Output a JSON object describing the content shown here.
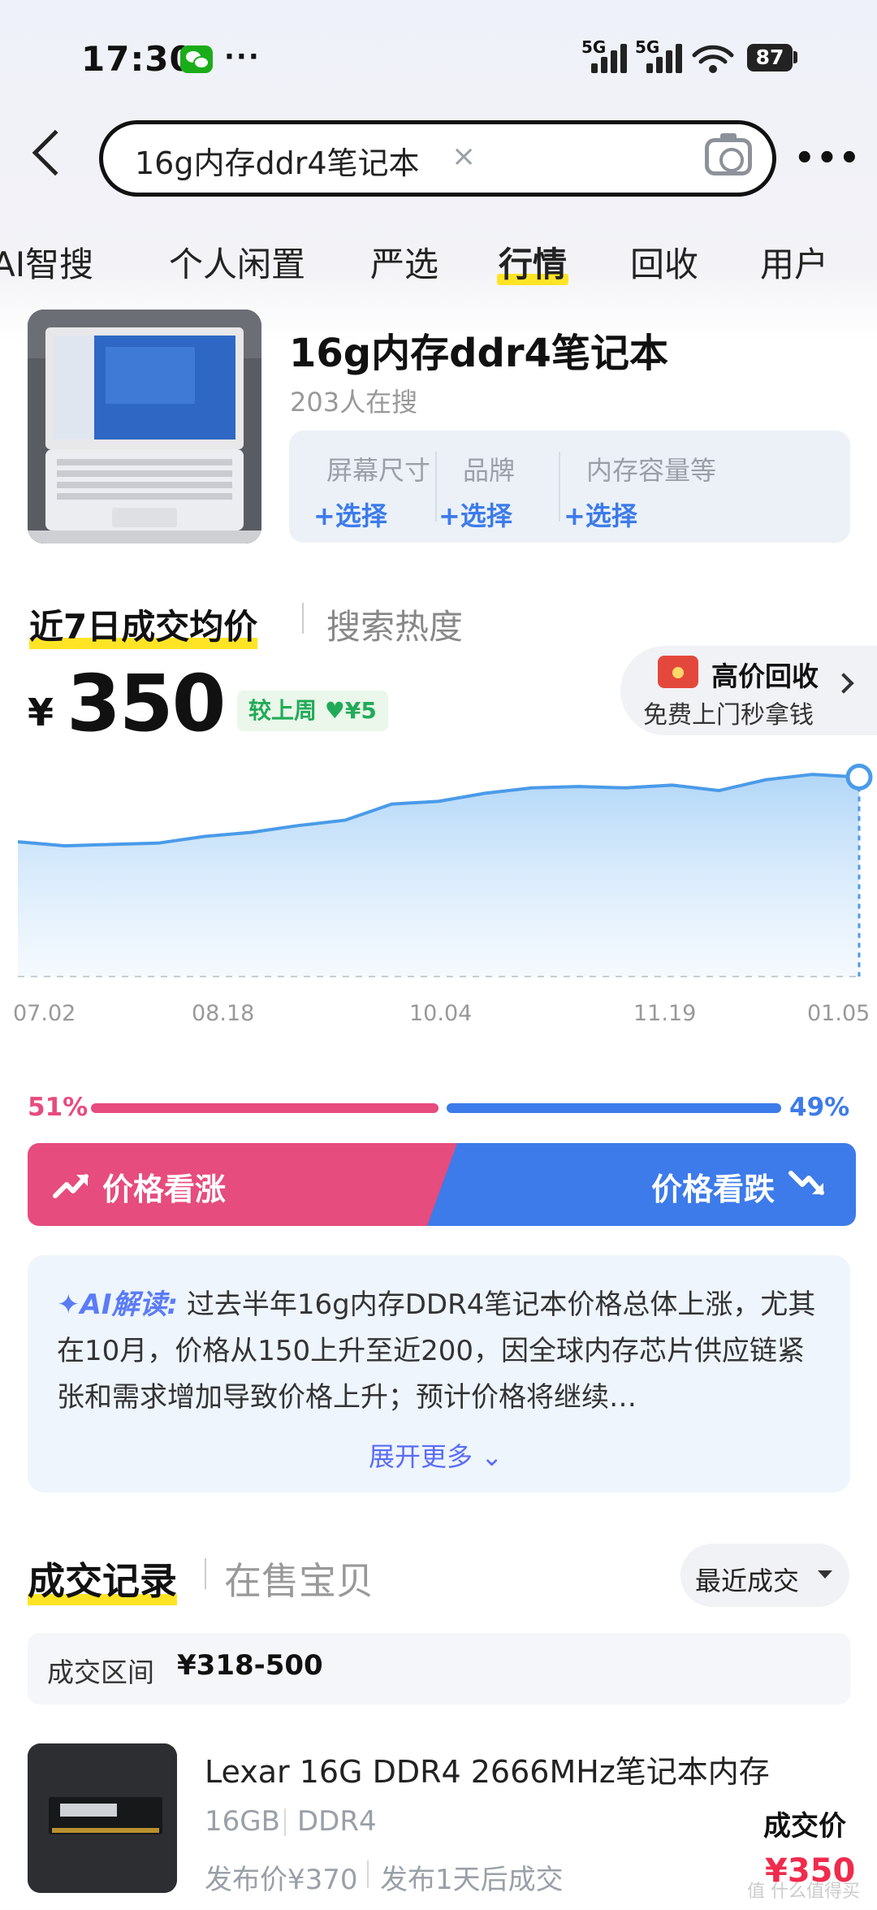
{
  "status_bar": {
    "time": "17:30",
    "battery": "87",
    "network": "5G"
  },
  "search": {
    "query": "16g内存ddr4笔记本",
    "clear": "×"
  },
  "tabs": [
    "AI智搜",
    "个人闲置",
    "严选",
    "行情",
    "回收",
    "用户"
  ],
  "active_tab": "行情",
  "product": {
    "title": "16g内存ddr4笔记本",
    "searchers": "203人在搜",
    "filters": [
      {
        "label": "屏幕尺寸",
        "action": "+选择"
      },
      {
        "label": "品牌",
        "action": "+选择"
      },
      {
        "label": "内存容量等",
        "action": "+选择"
      }
    ]
  },
  "price_section": {
    "tab_active": "近7日成交均价",
    "tab_inactive": "搜索热度",
    "currency": "¥",
    "price": "350",
    "change_text": "较上周 ♥¥5",
    "recycle_title": "高价回收",
    "recycle_subtitle": "免费上门秒拿钱"
  },
  "chart_data": {
    "type": "area",
    "x": [
      "07.02",
      "08.18",
      "10.04",
      "11.19",
      "01.05"
    ],
    "y": [
      350,
      347,
      348,
      349,
      354,
      357,
      362,
      366,
      378,
      380,
      386,
      390,
      391,
      390,
      392,
      388,
      396,
      400,
      398
    ],
    "color": "#4a9be8"
  },
  "vote": {
    "up_percent": "51%",
    "down_percent": "49%",
    "up_fraction": 0.51,
    "up_label": "价格看涨",
    "down_label": "价格看跌"
  },
  "ai_summary": {
    "label": "AI解读:",
    "text": "过去半年16g内存DDR4笔记本价格总体上涨，尤其在10月，价格从150上升至近200，因全球内存芯片供应链紧张和需求增加导致价格上升；预计价格将继续…",
    "more": "展开更多"
  },
  "records": {
    "tab_active": "成交记录",
    "tab_inactive": "在售宝贝",
    "sort": "最近成交",
    "range_label": "成交区间",
    "range_value": "¥318-500",
    "items": [
      {
        "title": "Lexar 16G DDR4 2666MHz笔记本内存",
        "spec1": "16GB",
        "spec2": "DDR4",
        "list_price": "发布价¥370",
        "sold_after": "发布1天后成交",
        "deal_label": "成交价",
        "deal_price": "¥350"
      }
    ]
  },
  "watermark": "值 什么值得买"
}
